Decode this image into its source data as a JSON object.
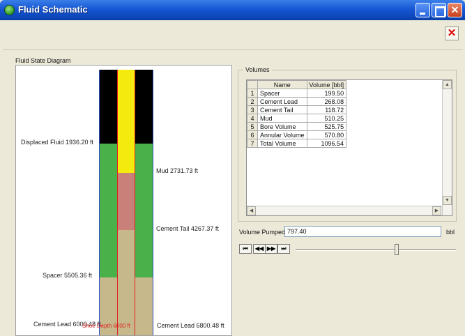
{
  "window": {
    "title": "Fluid Schematic",
    "close_x": "✕"
  },
  "diagram": {
    "section_label": "Fluid State Diagram",
    "labels": {
      "displaced_fluid": "Displaced Fluid 1936.20 ft",
      "mud": "Mud 2731.73 ft",
      "cement_tail": "Cement Tail 4267.37 ft",
      "spacer": "Spacer 5505.36 ft",
      "cement_lead_left": "Cement Lead 6000.48 ft",
      "cement_lead_right": "Cement Lead 6800.48 ft",
      "shoe_depth": "Shoe Depth 6000 ft"
    },
    "colors": {
      "black": "#000000",
      "yellow": "#f5ea0e",
      "green": "#4ab049",
      "pink": "#c88078",
      "tan": "#c6b88a",
      "red_line": "#e02020",
      "blue_line": "#3050c8"
    }
  },
  "volumes": {
    "legend": "Volumes",
    "headers": [
      "Name",
      "Volume [bbl]"
    ],
    "rows": [
      {
        "idx": "1",
        "name": "Spacer",
        "value": "199.50"
      },
      {
        "idx": "2",
        "name": "Cement Lead",
        "value": "268.08"
      },
      {
        "idx": "3",
        "name": "Cement Tail",
        "value": "118.72"
      },
      {
        "idx": "4",
        "name": "Mud",
        "value": "510.25"
      },
      {
        "idx": "5",
        "name": "Bore Volume",
        "value": "525.75"
      },
      {
        "idx": "6",
        "name": "Annular Volume",
        "value": "570.80"
      },
      {
        "idx": "7",
        "name": "Total Volume",
        "value": "1096.54"
      }
    ]
  },
  "pumped": {
    "label": "Volume Pumped",
    "value": "797.40",
    "unit": "bbl",
    "slider_fraction": 0.63
  },
  "playback": {
    "first": "⏮",
    "prev": "◀◀",
    "next": "▶▶",
    "last": "⏭"
  }
}
